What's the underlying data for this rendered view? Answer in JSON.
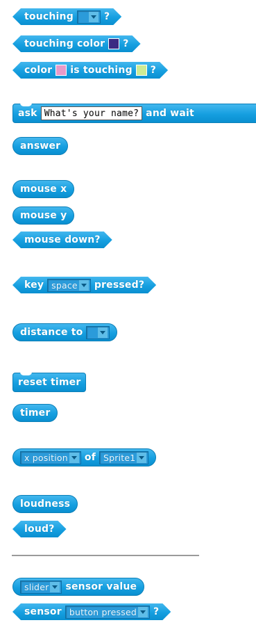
{
  "colors": {
    "block_blue": "#159fe0",
    "swatch_purple": "#3b2a83",
    "swatch_pink": "#e79ac9",
    "swatch_green": "#cdeb94",
    "divider": "#9a9a9a"
  },
  "touching": {
    "label": "touching",
    "suffix": "?"
  },
  "touching_color": {
    "label": "touching color",
    "suffix": "?"
  },
  "color_is_touching": {
    "prefix": "color",
    "middle": "is touching",
    "suffix": "?"
  },
  "ask": {
    "label": "ask",
    "input_value": "What's your name?",
    "suffix": "and wait"
  },
  "answer": {
    "label": "answer"
  },
  "mouse_x": {
    "label": "mouse x"
  },
  "mouse_y": {
    "label": "mouse y"
  },
  "mouse_down": {
    "label": "mouse down?"
  },
  "key_pressed": {
    "prefix": "key",
    "key_value": "space",
    "suffix": "pressed?"
  },
  "distance_to": {
    "label": "distance to"
  },
  "reset_timer": {
    "label": "reset timer"
  },
  "timer": {
    "label": "timer"
  },
  "attribute_of": {
    "attribute_value": "x position",
    "middle": "of",
    "sprite_value": "Sprite1"
  },
  "loudness": {
    "label": "loudness"
  },
  "loud": {
    "label": "loud?"
  },
  "sensor_value": {
    "sensor_value": "slider",
    "suffix": "sensor value"
  },
  "sensor_bool": {
    "prefix": "sensor",
    "sensor_value": "button pressed",
    "suffix": "?"
  }
}
